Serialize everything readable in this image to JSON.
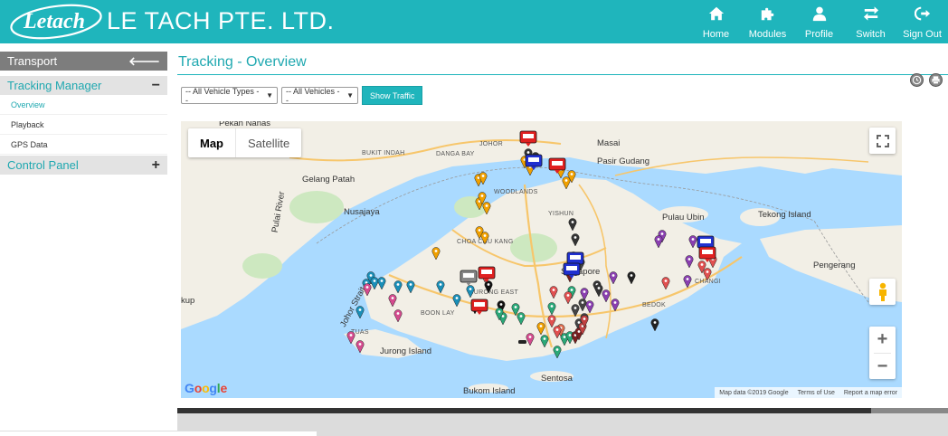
{
  "header": {
    "logo_text": "Letach",
    "company_name": "LE TACH PTE. LTD.",
    "nav": [
      {
        "label": "Home",
        "icon": "home-icon"
      },
      {
        "label": "Modules",
        "icon": "puzzle-icon"
      },
      {
        "label": "Profile",
        "icon": "user-icon"
      },
      {
        "label": "Switch",
        "icon": "switch-icon"
      },
      {
        "label": "Sign Out",
        "icon": "sign-out-icon"
      }
    ]
  },
  "sidebar": {
    "title": "Transport",
    "sections": [
      {
        "label": "Tracking Manager",
        "sign": "−",
        "items": [
          "Overview",
          "Playback",
          "GPS Data"
        ]
      },
      {
        "label": "Control Panel",
        "sign": "+"
      }
    ]
  },
  "main": {
    "title": "Tracking - Overview",
    "vehicle_type_select": "-- All Vehicle Types --",
    "vehicle_select": "-- All Vehicles --",
    "show_traffic_label": "Show Traffic"
  },
  "map": {
    "type_map": "Map",
    "type_satellite": "Satellite",
    "zoom_in": "+",
    "zoom_out": "−",
    "google": "Google",
    "attribution": [
      "Map data ©2019 Google",
      "Terms of Use",
      "Report a map error"
    ],
    "labels": [
      {
        "text": "Pekan Nanas",
        "cls": "big"
      },
      {
        "text": "JOHOR",
        "cls": "caps"
      },
      {
        "text": "Masai",
        "cls": "big"
      },
      {
        "text": "BUKIT INDAH",
        "cls": "caps"
      },
      {
        "text": "DANGA BAY",
        "cls": "caps"
      },
      {
        "text": "Pasir Gudang",
        "cls": "big"
      },
      {
        "text": "Gelang Patah",
        "cls": "big"
      },
      {
        "text": "WOODLANDS",
        "cls": "caps"
      },
      {
        "text": "Nusajaya",
        "cls": "big"
      },
      {
        "text": "Pulau Ubin",
        "cls": "big"
      },
      {
        "text": "Tekong Island",
        "cls": "big"
      },
      {
        "text": "YISHUN",
        "cls": "caps"
      },
      {
        "text": "CHOA CHU KANG",
        "cls": "caps"
      },
      {
        "text": "Singapore",
        "cls": "big"
      },
      {
        "text": "JURONG EAST",
        "cls": "caps"
      },
      {
        "text": "BOON LAY",
        "cls": "caps"
      },
      {
        "text": "TUAS",
        "cls": "caps"
      },
      {
        "text": "Jurong Island",
        "cls": "big"
      },
      {
        "text": "Pengerang",
        "cls": "big"
      },
      {
        "text": "BEDOK",
        "cls": "caps"
      },
      {
        "text": "CHANGI",
        "cls": "caps"
      },
      {
        "text": "Sentosa",
        "cls": "big"
      },
      {
        "text": "Bukom Island",
        "cls": "big"
      },
      {
        "text": "Johor Strait",
        "cls": "big"
      },
      {
        "text": "Pulai River",
        "cls": "big"
      },
      {
        "text": "kup",
        "cls": "big"
      }
    ]
  },
  "colors": {
    "brand": "#1fb5bc",
    "water": "#aadaff",
    "land": "#f2efe6"
  }
}
